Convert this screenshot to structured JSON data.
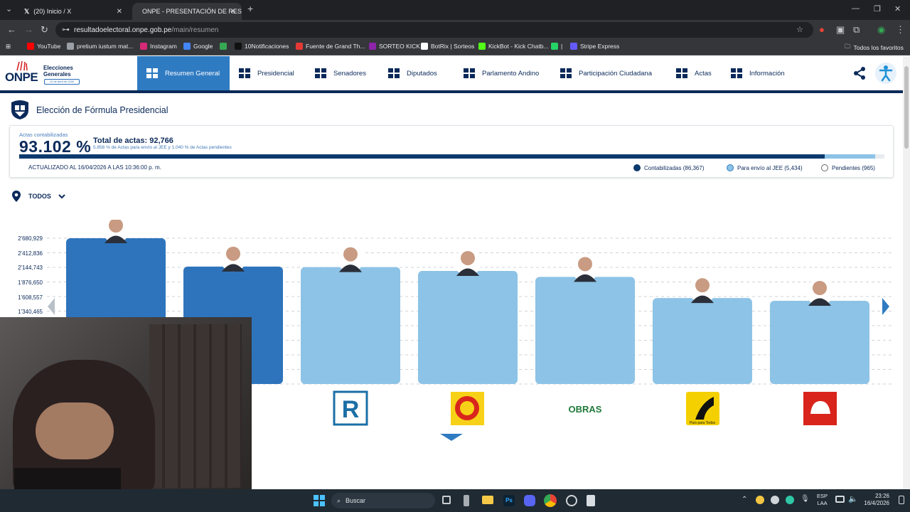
{
  "browser": {
    "tabs": [
      {
        "title": "(20) Inicio / X",
        "active": false
      },
      {
        "title": "ONPE - PRESENTACIÓN DE RES",
        "active": true
      }
    ],
    "new_tab": "+",
    "url_host": "resultadoelectoral.onpe.gob.pe",
    "url_path": "/main/resumen",
    "bookmarks": [
      {
        "label": "YouTube",
        "color": "#ff0000"
      },
      {
        "label": "pretium iustum mat...",
        "color": "#9aa0a6"
      },
      {
        "label": "Instagram",
        "color": "#d62976"
      },
      {
        "label": "Google",
        "color": "#4285f4"
      },
      {
        "label": "",
        "color": "#34a853"
      },
      {
        "label": "10Notificaciones",
        "color": "#111111"
      },
      {
        "label": "Fuente de Grand Th...",
        "color": "#e53935"
      },
      {
        "label": "SORTEO KICK",
        "color": "#8e24aa"
      },
      {
        "label": "BotRix | Sorteos",
        "color": "#ffffff"
      },
      {
        "label": "KickBot - Kick Chatb...",
        "color": "#53fc18"
      },
      {
        "label": "|",
        "color": "#25d366"
      },
      {
        "label": "Stripe Express",
        "color": "#635bff"
      }
    ],
    "all_bookmarks": "Todos los favoritos"
  },
  "site": {
    "logo_text": "ONPE",
    "logo_subtitle": "Elecciones Generales",
    "logo_date": "12 de abril de 2026",
    "nav": [
      {
        "label": "Resumen General",
        "icon": "dashboard-icon",
        "active": true
      },
      {
        "label": "Presidencial",
        "icon": "presidential-shield-icon",
        "active": false
      },
      {
        "label": "Senadores",
        "icon": "senate-icon",
        "active": false
      },
      {
        "label": "Diputados",
        "icon": "congress-building-icon",
        "active": false
      },
      {
        "label": "Parlamento Andino",
        "icon": "andean-globe-icon",
        "active": false
      },
      {
        "label": "Participación Ciudadana",
        "icon": "people-icon",
        "active": false
      },
      {
        "label": "Actas",
        "icon": "check-document-icon",
        "active": false
      },
      {
        "label": "Información",
        "icon": "info-document-icon",
        "active": false
      }
    ]
  },
  "summary": {
    "section_title": "Elección de Fórmula Presidencial",
    "actas_label": "Actas contabilizadas",
    "actas_pct": "93.102 %",
    "total_label": "Total de actas: 92,766",
    "total_sub": "5.858 % de Actas para envío al JEE y 1.040 % de Actas pendientes",
    "updated": "ACTUALIZADO AL 16/04/2026 A LAS 10:36:00 p. m.",
    "progress": {
      "contabilizadas_pct": 93.102,
      "jee_pct": 5.858,
      "pendientes_pct": 1.04
    },
    "legend": [
      {
        "label": "Contabilizadas (86,367)",
        "color": "#0b3a6e"
      },
      {
        "label": "Para envío al JEE (5,434)",
        "color": "#8dc3e6"
      },
      {
        "label": "Pendientes (965)",
        "color": "#ffffff"
      }
    ],
    "filter_label": "TODOS"
  },
  "chart_data": {
    "type": "bar",
    "y_ticks": [
      "2'680,929",
      "2'412,836",
      "2'144,743",
      "1'876,650",
      "1'608,557",
      "1'340,465"
    ],
    "ylim": [
      0,
      2680929
    ],
    "values": [
      2680929,
      2160000,
      2150000,
      2080000,
      1970000,
      1580000,
      1530000
    ],
    "colors": [
      "#2e74bc",
      "#2e74bc",
      "#8dc3e6",
      "#8dc3e6",
      "#8dc3e6",
      "#8dc3e6",
      "#8dc3e6"
    ],
    "party_logos": [
      "",
      "",
      "R",
      "sun-logo",
      "OBRAS",
      "País para Todos",
      "helmet-logo"
    ]
  },
  "taskbar": {
    "search": "Buscar",
    "lang": "ESP",
    "lang2": "LAA",
    "time": "23:26",
    "date": "16/4/2026"
  }
}
